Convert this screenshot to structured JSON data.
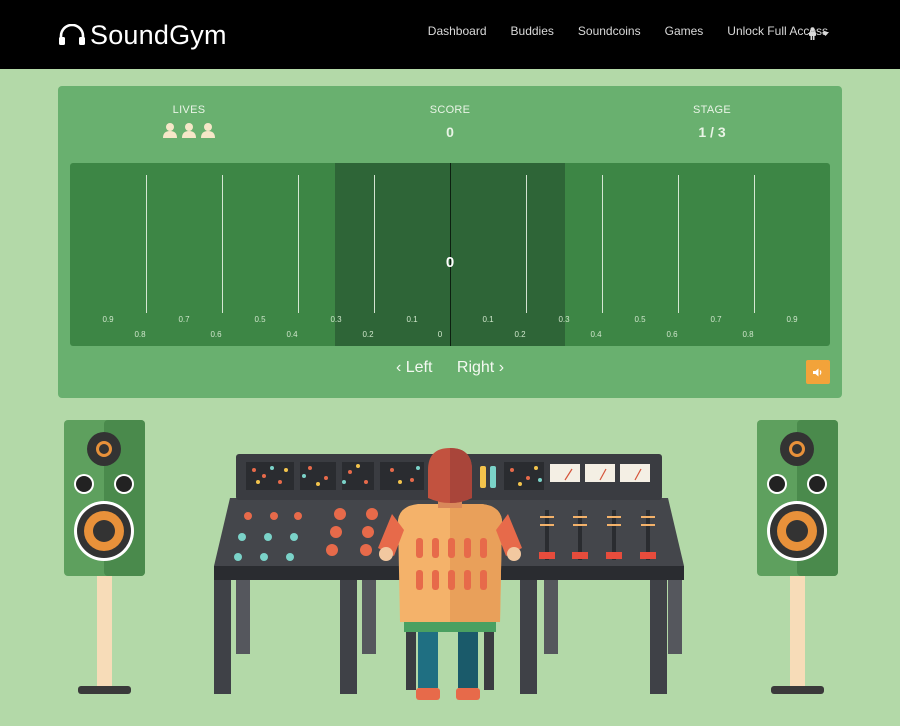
{
  "nav": {
    "brand": "SoundGym",
    "links": [
      {
        "label": "Dashboard"
      },
      {
        "label": "Buddies"
      },
      {
        "label": "Soundcoins"
      },
      {
        "label": "Games"
      },
      {
        "label": "Unlock Full Access"
      }
    ],
    "user_icon": "person-icon"
  },
  "game": {
    "lives_label": "LIVES",
    "lives": 3,
    "score_label": "SCORE",
    "score": "0",
    "stage_label": "STAGE",
    "stage": "1 / 3",
    "center_value": "0",
    "ticks_top": [
      "0.9",
      "0.7",
      "0.5",
      "0.3",
      "0.1",
      "0.1",
      "0.3",
      "0.5",
      "0.7",
      "0.9"
    ],
    "ticks_bottom": [
      "0.8",
      "0.6",
      "0.4",
      "0.2",
      "0",
      "0.2",
      "0.4",
      "0.6",
      "0.8"
    ],
    "left_label": "‹ Left",
    "right_label": "Right ›",
    "sound_icon": "speaker-icon"
  },
  "colors": {
    "navbar": "#000000",
    "page_bg": "#b3d9a8",
    "panel": "#69b06f",
    "track": "#3d8645",
    "center_zone": "#2e6537",
    "accent": "#f2a33a"
  }
}
